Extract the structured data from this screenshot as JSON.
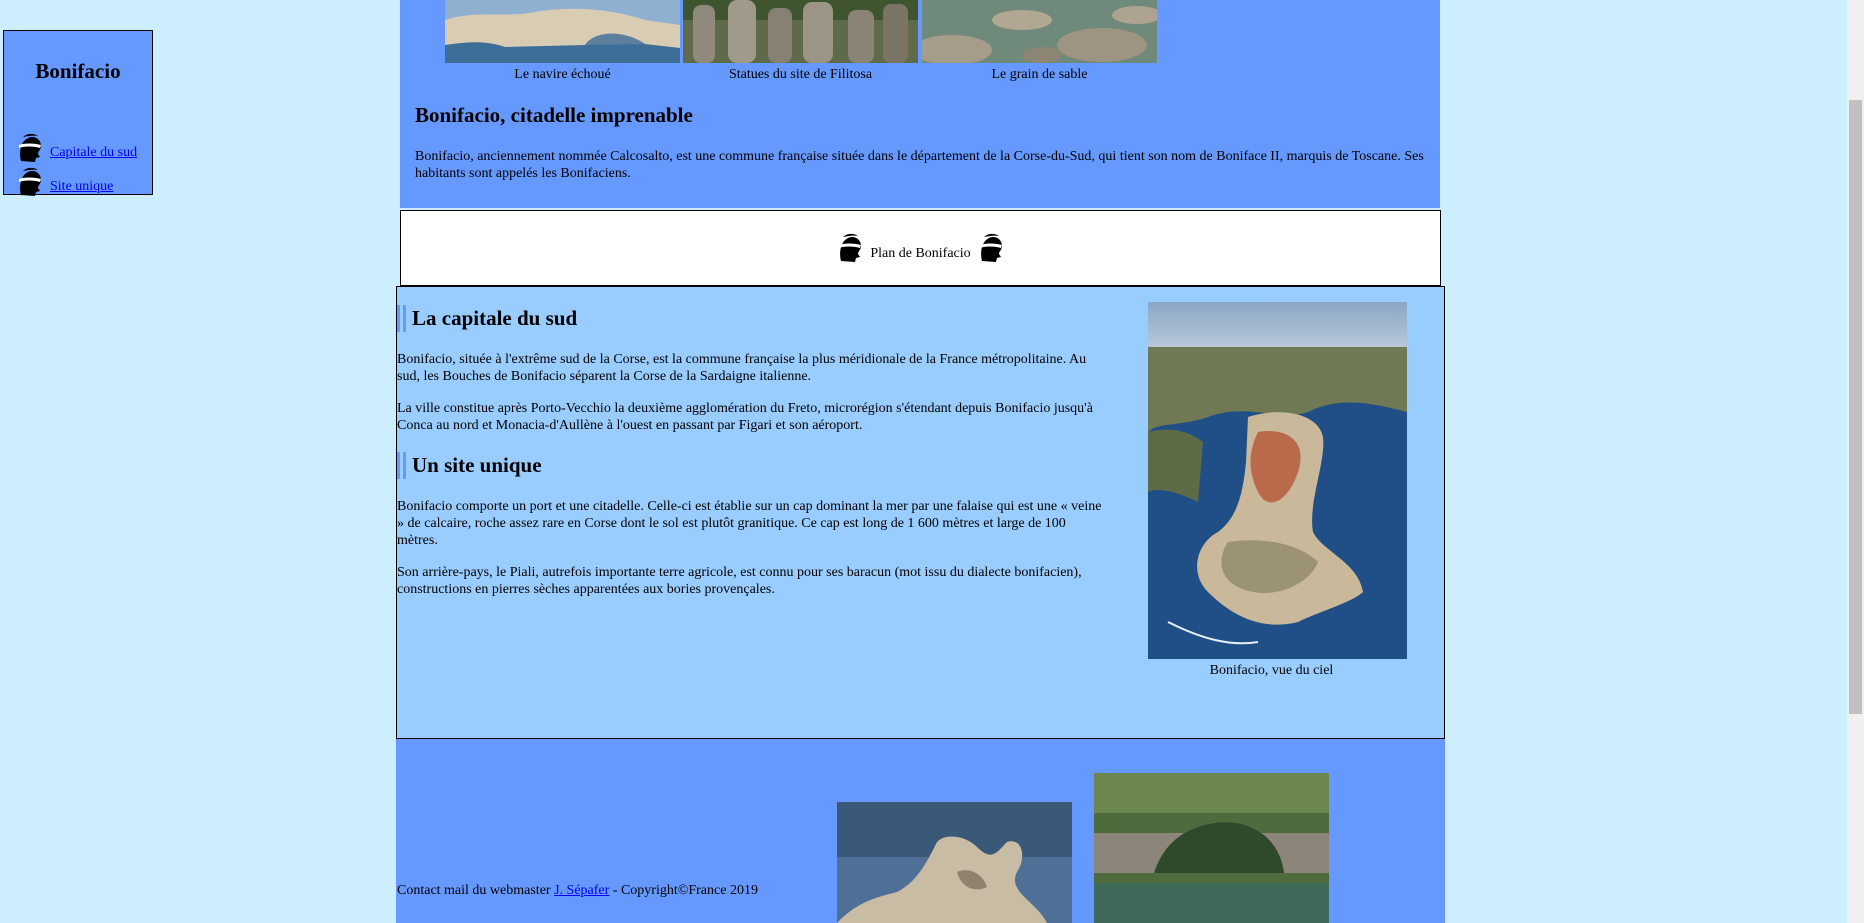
{
  "nav": {
    "title": "Bonifacio",
    "items": [
      {
        "label": "Capitale du sud",
        "icon": "moor-head-icon"
      },
      {
        "label": "Site unique",
        "icon": "moor-head-icon"
      }
    ]
  },
  "gallery": {
    "captions": [
      "Le navire échoué",
      "Statues du site de Filitosa",
      "Le grain de sable"
    ]
  },
  "header": {
    "title": "Bonifacio, citadelle imprenable",
    "intro": "Bonifacio, anciennement nommée Calcosalto, est une commune française située dans le département de la Corse-du-Sud, qui tient son nom de Boniface II, marquis de Toscane. Ses habitants sont appelés les Bonifaciens."
  },
  "plan": {
    "label": "Plan de Bonifacio"
  },
  "content": {
    "section1": {
      "title": "La capitale du sud",
      "p1": "Bonifacio, située à l'extrême sud de la Corse, est la commune française la plus méridionale de la France métropolitaine. Au sud, les Bouches de Bonifacio séparent la Corse de la Sardaigne italienne.",
      "p2": "La ville constitue après Porto-Vecchio la deuxième agglomération du Freto, microrégion s'étendant depuis Bonifacio jusqu'à Conca au nord et Monacia-d'Aullène à l'ouest en passant par Figari et son aéroport."
    },
    "section2": {
      "title": "Un site unique",
      "p1": "Bonifacio comporte un port et une citadelle. Celle-ci est établie sur un cap dominant la mer par une falaise qui est une « veine » de calcaire, roche assez rare en Corse dont le sol est plutôt granitique. Ce cap est long de 1 600 mètres et large de 100 mètres.",
      "p2": "Son arrière-pays, le Piali, autrefois importante terre agricole, est connu pour ses baracun (mot issu du dialecte bonifacien), constructions en pierres sèches apparentées aux bories provençales."
    },
    "image_caption": "Bonifacio, vue du ciel"
  },
  "footer": {
    "prefix": "Contact mail du webmaster ",
    "link": "J. Sépafer",
    "suffix": " - Copyright©France 2019"
  },
  "colors": {
    "page_bg": "#cdeeff",
    "section_bg": "#6699ff",
    "content_bg": "#99ccff",
    "link": "#0000ee"
  }
}
